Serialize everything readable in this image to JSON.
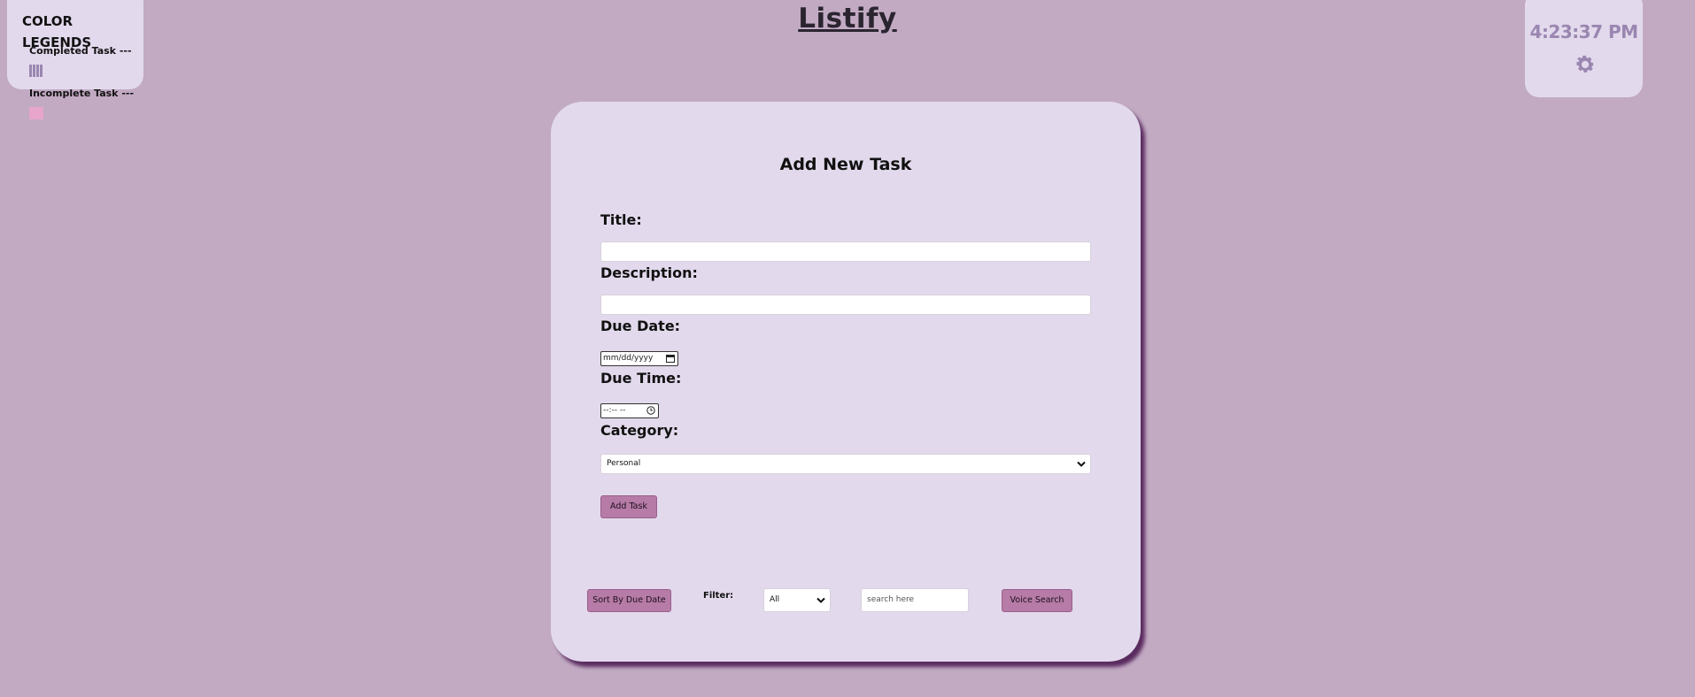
{
  "app": {
    "title": "Listify"
  },
  "legend": {
    "title": "COLOR LEGENDS",
    "completed_label": "Completed Task ---",
    "incomplete_label": "Incomplete Task ---",
    "completed_color": "#9a86b0",
    "incomplete_color": "#e7a5cc"
  },
  "clock": {
    "time": "4:23:37 PM",
    "icon": "gear-icon"
  },
  "form": {
    "heading": "Add New Task",
    "title_label": "Title:",
    "title_value": "",
    "description_label": "Description:",
    "description_value": "",
    "due_date_label": "Due Date:",
    "due_date_placeholder": "mm/dd/yyyy",
    "due_time_label": "Due Time:",
    "due_time_placeholder": "--:-- --",
    "category_label": "Category:",
    "category_value": "Personal",
    "add_button": "Add Task"
  },
  "toolbar": {
    "sort_button": "Sort By Due Date",
    "filter_label": "Filter:",
    "filter_value": "All",
    "search_placeholder": "search here",
    "voice_button": "Voice Search"
  },
  "colors": {
    "background": "#c2aac3",
    "card": "#e2d9ec",
    "button": "#b67ba6",
    "accent": "#9a86b0",
    "shadow": "#5a2b5f"
  }
}
